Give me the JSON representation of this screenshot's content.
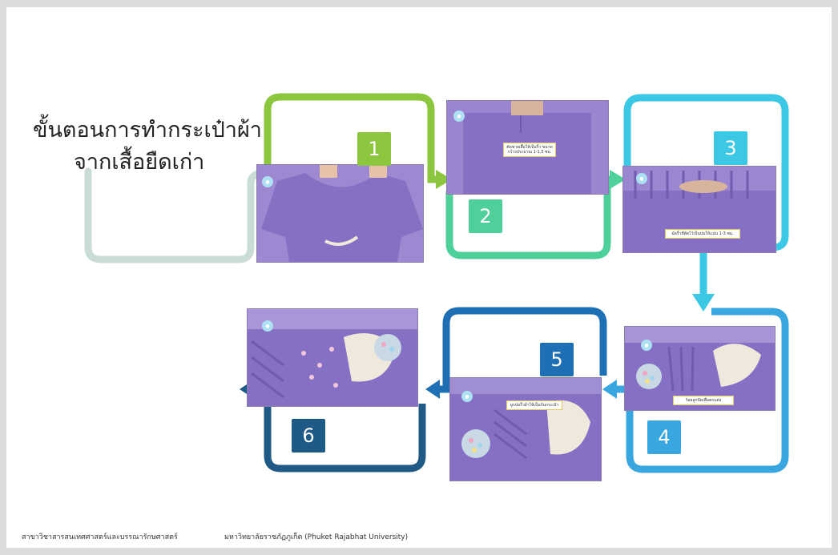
{
  "title": {
    "line1": "ขั้นตอนการทำกระเป๋าผ้า",
    "line2": "จากเสื้อยืดเก่า"
  },
  "steps": [
    {
      "number": "1",
      "caption": ""
    },
    {
      "number": "2",
      "caption": "ตัดชายเสื้อให้เป็นริ้ว ขนาดกว้างประมาณ 1-1.5 ซม."
    },
    {
      "number": "3",
      "caption": "มัดริ้วที่ตัดไว้เป็นปมให้แน่น 1-3 ซม."
    },
    {
      "number": "4",
      "caption": "ร้อยลูกปัดเพื่อตกแต่ง"
    },
    {
      "number": "5",
      "caption": "ผูกปมริ้วผ้าให้เป็นก้นกระเป๋า"
    },
    {
      "number": "6",
      "caption": ""
    }
  ],
  "colors": {
    "step1": "#8cc63f",
    "step2": "#4fcf9a",
    "step3": "#3cc7e5",
    "step4": "#3aa6e0",
    "step5": "#1f6fb5",
    "step6": "#1f5a86",
    "start": "#c9ddd6",
    "fabric": "#8f79c8"
  },
  "footer": {
    "department": "สาขาวิชาสารสนเทศศาสตร์และบรรณารักษศาสตร์",
    "university": "มหาวิทยาลัยราชภัฏภูเก็ต (Phuket Rajabhat University)"
  }
}
